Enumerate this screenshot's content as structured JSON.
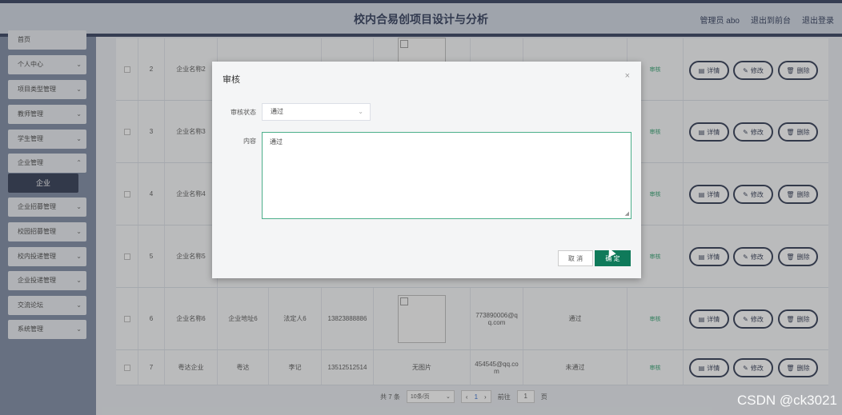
{
  "header": {
    "title": "校内合易创项目设计与分析",
    "admin": "管理员 abo",
    "back_front": "退出到前台",
    "logout": "退出登录"
  },
  "sidebar": {
    "items": [
      {
        "label": "首页"
      },
      {
        "label": "个人中心"
      },
      {
        "label": "项目类型管理"
      },
      {
        "label": "教师管理"
      },
      {
        "label": "学生管理"
      },
      {
        "label": "企业管理"
      },
      {
        "label": "企业招募管理"
      },
      {
        "label": "校园招募管理"
      },
      {
        "label": "校内投递管理"
      },
      {
        "label": "企业投递管理"
      },
      {
        "label": "交流论坛"
      },
      {
        "label": "系统管理"
      }
    ],
    "active_sub": "企业"
  },
  "table": {
    "rows": [
      {
        "num": "2",
        "name": "企业名称2",
        "addr": "",
        "legal": "",
        "phone": "",
        "image": "box",
        "email": "",
        "status": "",
        "audit": "审核"
      },
      {
        "num": "3",
        "name": "企业名称3",
        "addr": "",
        "legal": "",
        "phone": "",
        "image": "",
        "email": "",
        "status": "",
        "audit": "审核"
      },
      {
        "num": "4",
        "name": "企业名称4",
        "addr": "",
        "legal": "",
        "phone": "",
        "image": "",
        "email": "",
        "status": "",
        "audit": "审核"
      },
      {
        "num": "5",
        "name": "企业名称5",
        "addr": "",
        "legal": "",
        "phone": "",
        "image": "",
        "email": "",
        "status": "",
        "audit": "审核"
      },
      {
        "num": "6",
        "name": "企业名称6",
        "addr": "企业地址6",
        "legal": "法定人6",
        "phone": "13823888886",
        "image": "box",
        "email": "773890006@qq.com",
        "status": "通过",
        "audit": "审核"
      },
      {
        "num": "7",
        "name": "粤达企业",
        "addr": "粤达",
        "legal": "李记",
        "phone": "13512512514",
        "image": "无图片",
        "email": "454545@qq.com",
        "status": "未通过",
        "audit": "审核"
      }
    ],
    "actions": {
      "detail": "详情",
      "edit": "修改",
      "delete": "删除"
    }
  },
  "pager": {
    "total": "共 7 条",
    "page_size": "10条/页",
    "current": "1",
    "goto_label": "前往",
    "goto_value": "1",
    "page_suffix": "页"
  },
  "dialog": {
    "title": "审核",
    "status_label": "审核状态",
    "status_value": "通过",
    "content_label": "内容",
    "content_value": "通过",
    "cancel": "取 消",
    "ok": "确 定"
  },
  "watermark": "CSDN @ck3021"
}
